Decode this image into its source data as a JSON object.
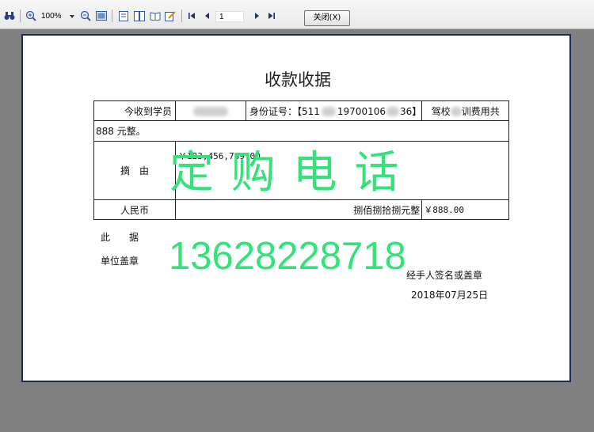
{
  "toolbar": {
    "zoom": "100%",
    "page_number": "1",
    "close_label": "关闭(X)",
    "icons": [
      "binoculars-icon",
      "zoom-in-icon",
      "zoom-out-icon",
      "page-view-icon",
      "single-page-icon",
      "two-page-icon",
      "book-icon",
      "edit-icon",
      "first-page-icon",
      "prev-page-icon",
      "next-page-icon",
      "last-page-icon"
    ]
  },
  "receipt": {
    "title": "收款收据",
    "row1": {
      "student_label": "今收到学员",
      "id_label": "身份证号：【511",
      "id_mid": "19700106",
      "id_end": "36】",
      "school_prefix": "驾校",
      "school_suffix": "训费用共"
    },
    "row2": {
      "amount_text": "888 元整。"
    },
    "row3": {
      "label": "摘　由",
      "value": "￥123,456,789.00"
    },
    "row4": {
      "label": "人民币",
      "uppercase": "捌佰捌拾捌元整",
      "value": "￥888.00"
    },
    "footer": {
      "cishu": "此　　据",
      "seal": "单位盖章",
      "signer": "经手人签名或盖章",
      "date": "2018年07月25日"
    }
  },
  "watermark": {
    "line1": "定 购 电 话",
    "line2": "13628228718",
    "color": "#35e27a"
  }
}
